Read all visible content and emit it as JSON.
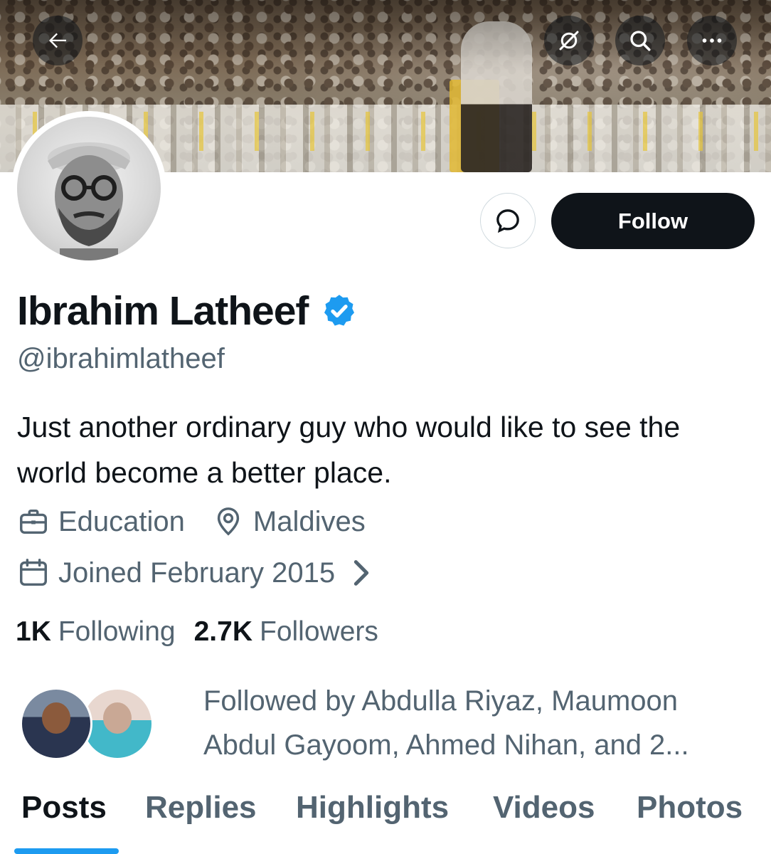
{
  "header": {
    "back_icon": "arrow-left-icon",
    "grok_icon": "grok-icon",
    "search_icon": "search-icon",
    "more_icon": "more-dots-icon"
  },
  "profile": {
    "name": "Ibrahim Latheef",
    "verified": true,
    "handle": "@ibrahimlatheef",
    "bio": "Just another ordinary guy who would like to see the world become a better place.",
    "category": "Education",
    "location": "Maldives",
    "joined": "Joined February 2015",
    "following_count": "1K",
    "following_label": "Following",
    "followers_count": "2.7K",
    "followers_label": "Followers",
    "followed_by": "Followed by Abdulla Riyaz, Maumoon Abdul Gayoom, Ahmed Nihan, and 2..."
  },
  "actions": {
    "follow_label": "Follow",
    "message_icon": "message-bubble-icon"
  },
  "tabs": [
    {
      "label": "Posts",
      "active": true
    },
    {
      "label": "Replies",
      "active": false
    },
    {
      "label": "Highlights",
      "active": false
    },
    {
      "label": "Videos",
      "active": false
    },
    {
      "label": "Photos",
      "active": false
    }
  ],
  "colors": {
    "accent": "#1d9bf0",
    "text_primary": "#0f1419",
    "text_secondary": "#536471",
    "follow_button": "#0f1419"
  }
}
